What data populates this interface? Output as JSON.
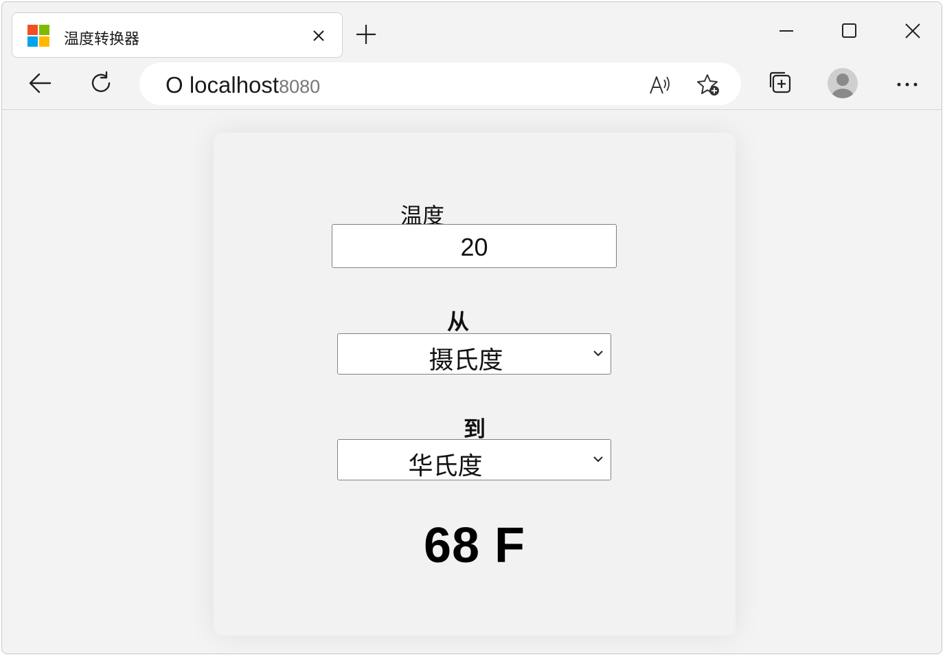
{
  "browser": {
    "tab": {
      "title": "温度转换器"
    },
    "address_bar": {
      "host": "O localhost",
      "port": "8080"
    },
    "icons": [
      "microsoft-logo-icon",
      "close-icon",
      "plus-icon",
      "minimize-icon",
      "maximize-icon",
      "back-icon",
      "refresh-icon",
      "read-aloud-icon",
      "add-favorite-icon",
      "collections-icon",
      "profile-icon",
      "more-icon"
    ]
  },
  "colors": {
    "logo_red": "#f25022",
    "logo_green": "#7fba00",
    "logo_blue": "#00a4ef",
    "logo_yellow": "#ffb900"
  },
  "form": {
    "temperature_label": "温度",
    "temperature_value": "20",
    "from_label": "从",
    "from_selected": "摄氏度",
    "to_label": "到",
    "to_selected": "华氏度",
    "result": "68 F"
  }
}
